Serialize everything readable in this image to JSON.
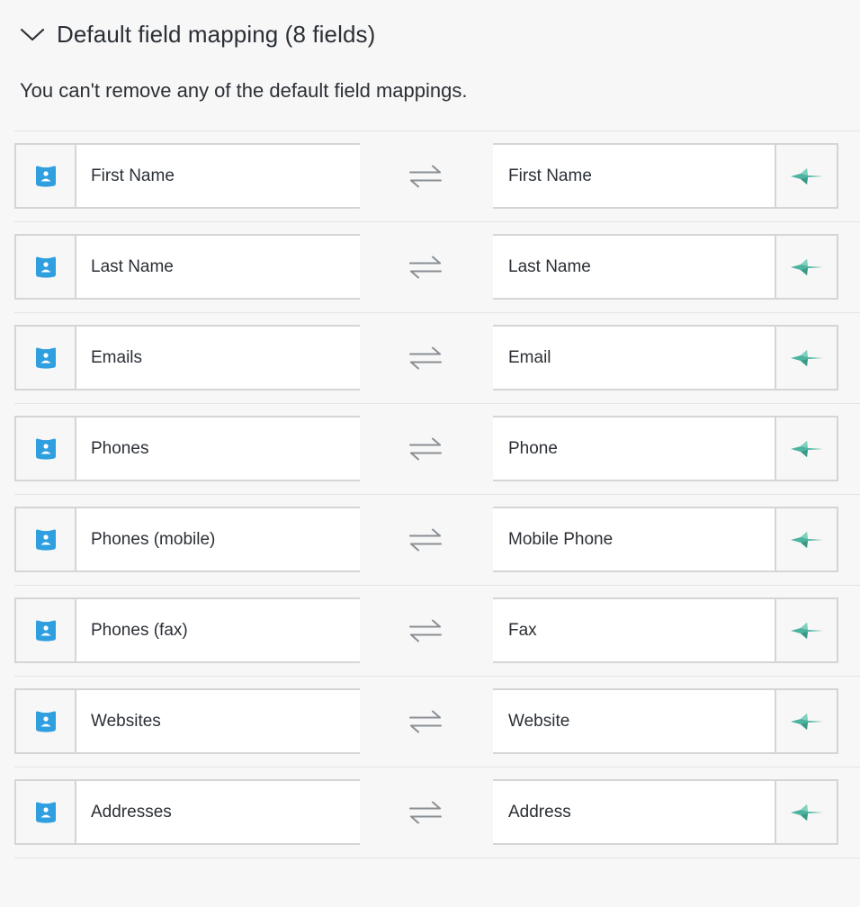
{
  "section": {
    "title": "Default field mapping (8 fields)",
    "note": "You can't remove any of the default field mappings.",
    "expanded_icon": "chevron-down-icon"
  },
  "colors": {
    "contact_icon": "#2f9fe0",
    "brand_icon": "#4bb39f",
    "swap_icon": "#8a8f94",
    "border": "#d5d5d5",
    "background": "#f7f7f7"
  },
  "icons": {
    "left_source": "contact-card-icon",
    "right_source": "teal-brand-icon",
    "swap": "swap-arrows-icon"
  },
  "mappings": [
    {
      "left": "First Name",
      "right": "First Name"
    },
    {
      "left": "Last Name",
      "right": "Last Name"
    },
    {
      "left": "Emails",
      "right": "Email"
    },
    {
      "left": "Phones",
      "right": "Phone"
    },
    {
      "left": "Phones (mobile)",
      "right": "Mobile Phone"
    },
    {
      "left": "Phones (fax)",
      "right": "Fax"
    },
    {
      "left": "Websites",
      "right": "Website"
    },
    {
      "left": "Addresses",
      "right": "Address"
    }
  ]
}
